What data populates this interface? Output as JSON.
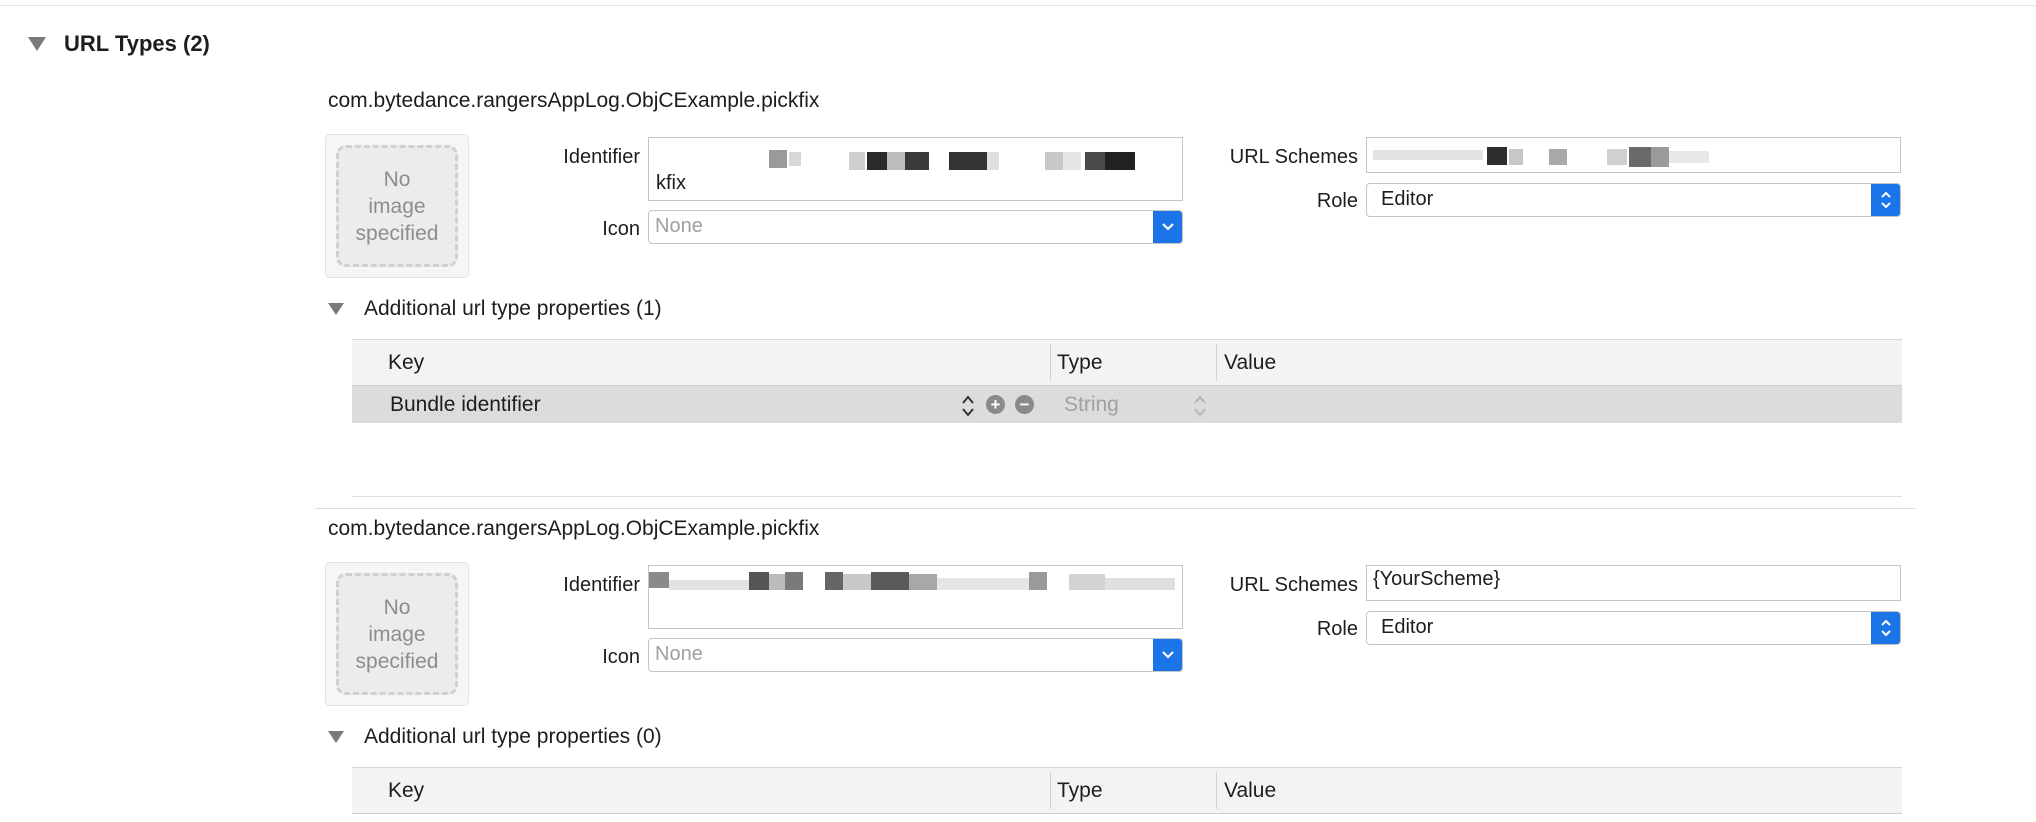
{
  "section": {
    "title": "URL Types (2)"
  },
  "labels": {
    "identifier": "Identifier",
    "icon": "Icon",
    "url_schemes": "URL Schemes",
    "role": "Role",
    "no_image": [
      "No",
      "image",
      "specified"
    ]
  },
  "icons": {
    "disclosure": "disclosure-triangle-icon",
    "popup": "chevron-down-icon",
    "stepper": "up-down-stepper-icon",
    "add": "plus-circle-icon",
    "remove": "minus-circle-icon"
  },
  "colors": {
    "accent": "#1b74e8",
    "selected_row": "#dcdcdc"
  },
  "url_types": [
    {
      "title": "com.bytedance.rangersAppLog.ObjCExample.pickfix",
      "identifier_visible": "kfix",
      "icon_placeholder": "None",
      "url_schemes_value": "",
      "role_value": "Editor",
      "props_title": "Additional url type properties (1)",
      "table": {
        "headers": {
          "key": "Key",
          "type": "Type",
          "value": "Value"
        },
        "rows": [
          {
            "key": "Bundle identifier",
            "type": "String",
            "value": ""
          }
        ]
      }
    },
    {
      "title": "com.bytedance.rangersAppLog.ObjCExample.pickfix",
      "identifier_visible": "",
      "icon_placeholder": "None",
      "url_schemes_value": "{YourScheme}",
      "role_value": "Editor",
      "props_title": "Additional url type properties (0)",
      "table": {
        "headers": {
          "key": "Key",
          "type": "Type",
          "value": "Value"
        },
        "rows": []
      }
    }
  ]
}
